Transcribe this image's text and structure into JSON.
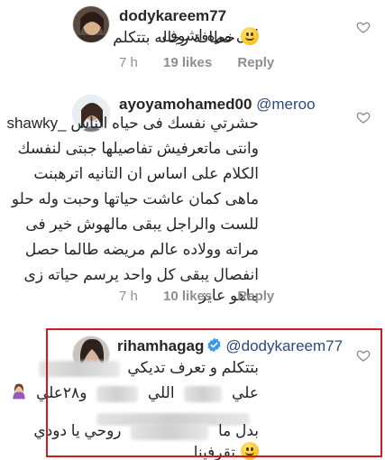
{
  "comments": [
    {
      "username": "dodykareem77",
      "lines": [
        "اول مره اشوف",
        "خطافة رجاله بتتكلم"
      ],
      "time": "7 h",
      "likes": "19 likes",
      "reply": "Reply"
    },
    {
      "username": "ayoyamohamed00",
      "mention": "@meroo",
      "lines": [
        "حشرتي نفسك فى حياه الناس _shawky",
        "وانتى ماتعرفيش تفاصيلها جبتى لنفسك",
        "الكلام على اساس ان التانيه اترهبنت",
        "ماهى كمان عاشت حياتها وحبت وله حلو",
        "للست والراجل يبقى مالهوش خير فى",
        "مراته وولاده عالم مريضه طالما حصل",
        "انفصال يبقى كل واحد يرسم حياته زى",
        "ماهو عايز"
      ],
      "time": "7 h",
      "likes": "10 likes",
      "reply": "Reply"
    },
    {
      "username": "rihamhagag",
      "mention": "@dodykareem77",
      "lines": [
        "بتتكلم و تعرف تديكي",
        "و٢٨علي",
        "اللي",
        "علي",
        "روحي يا دودي",
        "بدل ما",
        "تقرفينا"
      ]
    }
  ],
  "icons": {
    "heart": "heart-outline-icon",
    "verified": "verified-badge-icon",
    "smile": "smiling-face-emoji",
    "woman": "woman-facepalming-emoji"
  },
  "colors": {
    "text": "#262626",
    "meta": "#8e8e8e",
    "mention": "#2b4a7e",
    "verified": "#3897f0",
    "highlight": "#d01c1c"
  }
}
